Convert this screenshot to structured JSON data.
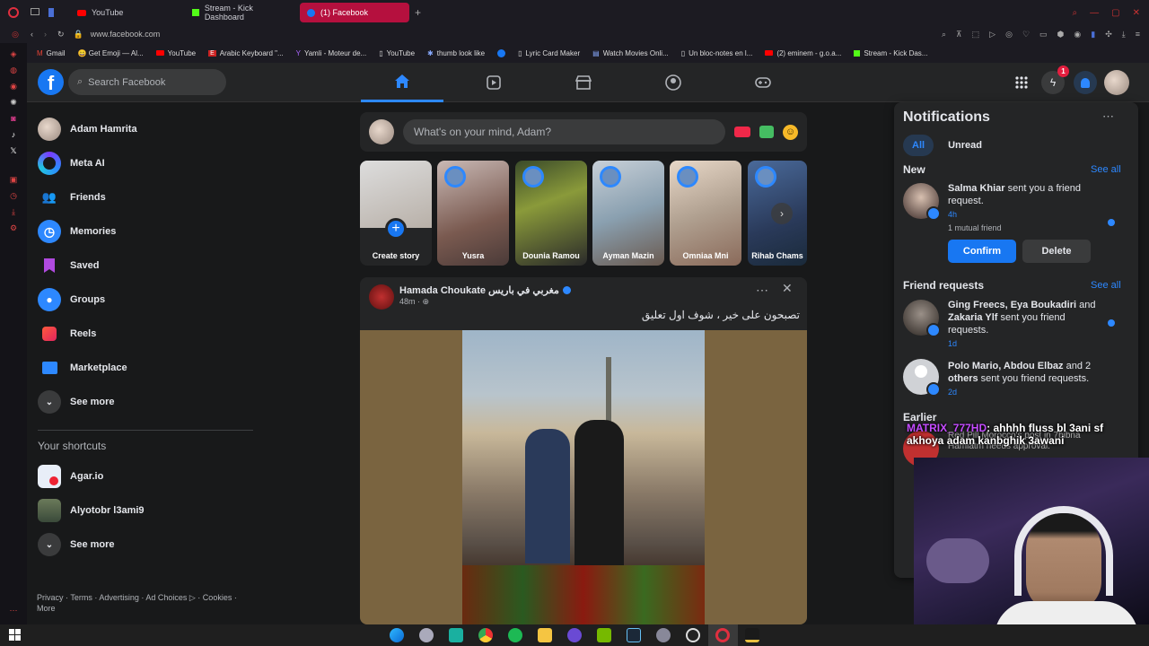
{
  "browser": {
    "tabs": [
      {
        "label": "YouTube",
        "color": "#ff0000"
      },
      {
        "label": "Stream - Kick Dashboard",
        "color": "#53fc18"
      },
      {
        "label": "(1) Facebook",
        "color": "#1877f2"
      }
    ],
    "url": "www.facebook.com",
    "bookmarks": [
      "Gmail",
      "😀 Get Emoji — Al...",
      "YouTube",
      "Arabic Keyboard \"...",
      "Yamli - Moteur de...",
      "YouTube",
      "thumb look like",
      "",
      "Lyric Card Maker",
      "Watch Movies Onli...",
      "Un bloc-notes en l...",
      "(2) eminem - g.o.a...",
      "Stream - Kick Das..."
    ]
  },
  "fb_header": {
    "search_placeholder": "Search Facebook",
    "notification_badge": "1",
    "accent": "#2d88ff"
  },
  "left_nav": {
    "items": [
      {
        "label": "Adam Hamrita",
        "icon": "avatar"
      },
      {
        "label": "Meta AI",
        "icon": "meta-ai-icon"
      },
      {
        "label": "Friends",
        "icon": "friends-icon"
      },
      {
        "label": "Memories",
        "icon": "clock-icon"
      },
      {
        "label": "Saved",
        "icon": "bookmark-icon"
      },
      {
        "label": "Groups",
        "icon": "groups-icon"
      },
      {
        "label": "Reels",
        "icon": "reels-icon"
      },
      {
        "label": "Marketplace",
        "icon": "store-icon"
      },
      {
        "label": "See more",
        "icon": "chevron-down-icon"
      }
    ],
    "shortcuts_title": "Your shortcuts",
    "shortcuts": [
      {
        "label": "Agar.io"
      },
      {
        "label": "Alyotobr l3ami9"
      },
      {
        "label": "See more"
      }
    ],
    "footer": "Privacy · Terms · Advertising · Ad Choices ▷ · Cookies ·",
    "footer_more": "More"
  },
  "composer": {
    "placeholder": "What's on your mind, Adam?"
  },
  "stories": [
    {
      "name": "Create story"
    },
    {
      "name": "Yusra"
    },
    {
      "name": "Dounia Ramou"
    },
    {
      "name": "Ayman Mazin"
    },
    {
      "name": "Omniaa Mni"
    },
    {
      "name": "Rihab Chams"
    }
  ],
  "post": {
    "author": "Hamada Choukate مغربي في باريس",
    "time": "48m · ",
    "text": "تصبحون على خير ، شوف اول تعليق"
  },
  "notifications": {
    "title": "Notifications",
    "tabs": [
      "All",
      "Unread"
    ],
    "new_title": "New",
    "see_all": "See all",
    "new_item": {
      "name": "Salma Khiar",
      "text": " sent you a friend request.",
      "time": "4h",
      "mutual": "1 mutual friend"
    },
    "confirm": "Confirm",
    "delete": "Delete",
    "fr_title": "Friend requests",
    "fr_items": [
      {
        "names": "Ging Freecs, Eya Boukadiri",
        "and": " and ",
        "name2": "Zakaria Ylf",
        "text": " sent you friend requests.",
        "time": "1d"
      },
      {
        "names": "Polo Mario, Abdou Elbaz",
        "and": " and 2 ",
        "name2": "others",
        "text": " sent you friend requests.",
        "time": "2d"
      }
    ],
    "earlier_title": "Earlier",
    "earlier_item": "Red Pill Morocco's post in 7bibna Hamlatm needs approval."
  },
  "chat_overlay": {
    "user": "MATRIX_777HD",
    "message": ": ahhhh fluss bl 3ani sf akhoya adam kanbghik 3awani"
  }
}
